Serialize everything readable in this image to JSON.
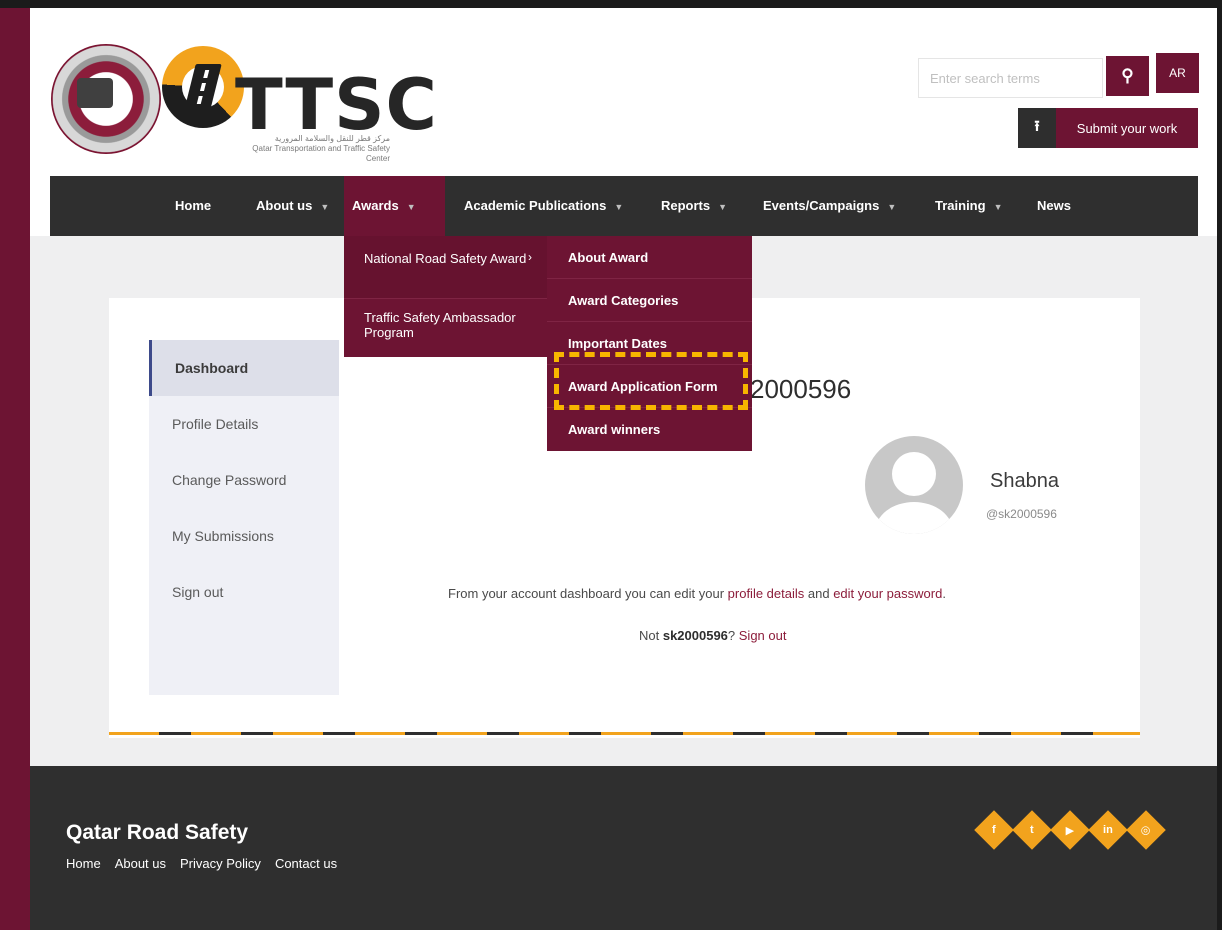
{
  "header": {
    "brand": "TTSC",
    "brand_subtitle_ar": "مركز قطر للنقل والسلامة المرورية",
    "brand_subtitle_en": "Qatar Transportation and Traffic Safety Center",
    "search_placeholder": "Enter search terms",
    "search_icon": "magnifier-icon",
    "lang_button": "AR",
    "submit_icon": "upload-icon",
    "submit_label": "Submit your work"
  },
  "nav": {
    "items": [
      {
        "label": "Home",
        "caret": ""
      },
      {
        "label": "About us",
        "caret": "▼"
      },
      {
        "label": "Awards",
        "caret": "▼"
      },
      {
        "label": "Academic Publications",
        "caret": "▼"
      },
      {
        "label": "Reports",
        "caret": "▼"
      },
      {
        "label": "Events/Campaigns",
        "caret": "▼"
      },
      {
        "label": "Training",
        "caret": "▼"
      },
      {
        "label": "News",
        "caret": ""
      }
    ]
  },
  "awards_menu": {
    "items": [
      {
        "label": "National Road Safety Award"
      },
      {
        "label": "Traffic Safety Ambassador Program"
      }
    ],
    "submenu_arrow": "›"
  },
  "award_submenu": {
    "items": [
      {
        "label": "About Award"
      },
      {
        "label": "Award Categories"
      },
      {
        "label": "Important Dates"
      },
      {
        "label": "Award Application Form"
      },
      {
        "label": "Award winners"
      }
    ]
  },
  "sidebar": {
    "items": [
      {
        "label": "Dashboard"
      },
      {
        "label": "Profile Details"
      },
      {
        "label": "Change Password"
      },
      {
        "label": "My Submissions"
      },
      {
        "label": "Sign out"
      }
    ]
  },
  "account": {
    "username_title": "2000596",
    "display_name": "Shabna",
    "handle": "@sk2000596",
    "info_prefix": "From your account dashboard you can edit your ",
    "info_link1": "profile details",
    "info_mid": " and ",
    "info_link2": "edit your password",
    "info_suffix": ".",
    "not_prefix": "Not ",
    "not_user": "sk2000596",
    "not_q": "? ",
    "not_link": "Sign out"
  },
  "footer": {
    "title": "Qatar Road Safety",
    "links": [
      "Home",
      "About us",
      "Privacy Policy",
      "Contact us"
    ],
    "socials": [
      "f",
      "t",
      "▶",
      "in",
      "◎"
    ]
  },
  "colors": {
    "brand_maroon": "#6d1433",
    "accent_gold": "#f2a31d",
    "nav_dark": "#2f2f2f",
    "highlight": "#f7b500"
  }
}
